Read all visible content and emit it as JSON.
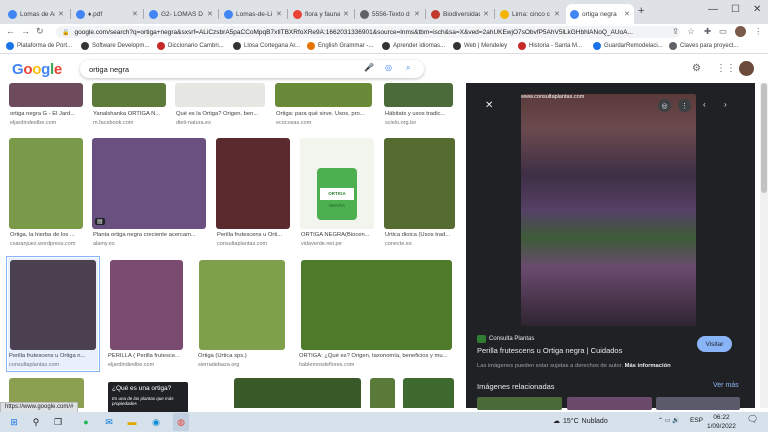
{
  "browser": {
    "tabs": [
      {
        "label": "Lomas de Ar",
        "color": "#4285f4"
      },
      {
        "label": "♦.pdf",
        "color": "#4285f4"
      },
      {
        "label": "G2- LOMAS D",
        "color": "#4285f4"
      },
      {
        "label": "Lomas-de-Li",
        "color": "#4285f4"
      },
      {
        "label": "flora y fauna",
        "color": "#e94235"
      },
      {
        "label": "5556-Texto d",
        "color": "#5f6368"
      },
      {
        "label": "Biodiversidad",
        "color": "#c0392b"
      },
      {
        "label": "Lima: cinco c",
        "color": "#f4b400"
      },
      {
        "label": "ortiga negra",
        "color": "#4285f4"
      }
    ],
    "new_tab_label": "+",
    "window_controls": {
      "minimize": "—",
      "maximize": "☐",
      "close": "✕"
    },
    "url": "google.com/search?q=ortiga+negra&sxsrf=ALiCzsbrA5paCCoMpqB7xIlTBXRfoXRe9A:1662031336901&source=lnms&tbm=isch&sa=X&ved=2ahUKEwjO7sObvfP5AhV5lLkGHbhlANoQ_AUoA..."
  },
  "bookmarks": [
    {
      "label": "Plataforma de Port...",
      "color": "#1a73e8"
    },
    {
      "label": "Software Developm...",
      "color": "#333333"
    },
    {
      "label": "Diccionario Cambri...",
      "color": "#c62828"
    },
    {
      "label": "Llosa Cortegana Ar...",
      "color": "#333333"
    },
    {
      "label": "English Grammar -...",
      "color": "#e37400"
    },
    {
      "label": "Aprender idiomas...",
      "color": "#333333"
    },
    {
      "label": "Web | Mendeley",
      "color": "#333333"
    },
    {
      "label": "Historia - Santa M...",
      "color": "#c62828"
    },
    {
      "label": "GuardarRemodelaci...",
      "color": "#1a73e8"
    },
    {
      "label": "Claves para proyect...",
      "color": "#5f6368"
    }
  ],
  "google": {
    "logo": "Google",
    "query": "ortiga negra"
  },
  "results": [
    {
      "caption": "ortiga negra G - El Jard...",
      "source": "eljardindeelbe.com",
      "color": "#6d4a5c"
    },
    {
      "caption": "Yanalshanka ORTIGA N...",
      "source": "m.facebook.com",
      "color": "#5e7a3a"
    },
    {
      "caption": "Qué es la Ortiga? Origen, ben...",
      "source": "dieti-natura.es",
      "color": "#e6e6e2"
    },
    {
      "caption": "Ortiga: para qué sirve. Usos, pro...",
      "source": "ecocosas.com",
      "color": "#6a8a3a"
    },
    {
      "caption": "Hábitats y usos tradic...",
      "source": "scielo.org.bo",
      "color": "#4b6b3a"
    },
    {
      "caption": "Ortiga, la hierba de los ...",
      "source": "csaranjuez.wordpress.com",
      "color": "#7a9a4a"
    },
    {
      "caption": "Planta ortiga negra creciente acercam...",
      "source": "alamy.es",
      "color": "#6a5080"
    },
    {
      "caption": "Perilla frutescens u Orti...",
      "source": "consultaplantas.com",
      "color": "#5b2a2e"
    },
    {
      "caption": "ORTIGA NEGRA(Biocen...",
      "source": "vidaverde.net.pe",
      "color": "#f1f5ee"
    },
    {
      "caption": "Urtica dioica (Usos trad...",
      "source": "conecte.es",
      "color": "#556b2f"
    },
    {
      "caption": "Perilla frutescens u Ortiga n...",
      "source": "consultaplantas.com",
      "color": "#4a4050"
    },
    {
      "caption": "PERILLA ( Perilla frutesce...",
      "source": "eljardindeelbe.com",
      "color": "#7a4a70"
    },
    {
      "caption": "Ortiga (Urtica sps.)",
      "source": "sierradebaza.org",
      "color": "#7fa04a"
    },
    {
      "caption": "ORTIGA: ¿Qué es? Origen, taxonomía, beneficios y mu...",
      "source": "hablemosdeflores.com",
      "color": "#4f7a2a"
    },
    {
      "caption": "",
      "source": "",
      "color": "#8aa050"
    },
    {
      "caption": "",
      "source": "",
      "color": "#3a5a2a"
    },
    {
      "caption": "",
      "source": "",
      "color": "#5a7a3a"
    },
    {
      "caption": "",
      "source": "",
      "color": "#3f6a2f"
    }
  ],
  "vidaverde_label": "ORTIGA NEGRA",
  "tooltip": {
    "title": "¿Qué es una ortiga?",
    "subtitle": "Es una de las plantas que más propiedades"
  },
  "panel": {
    "watermark": "www.consultaplantas.com",
    "source_name": "Consulta Plantas",
    "title": "Perilla frutescens u Ortiga negra | Cuidados",
    "visit_label": "Visitar",
    "note": "Las imágenes pueden estar sujetas a derechos de autor.",
    "note_link": "Más información",
    "related_label": "Imágenes relacionadas",
    "more_label": "Ver más"
  },
  "status_url": "https://www.google.com/#",
  "taskbar": {
    "temperature": "15°C",
    "weather": "Nublado",
    "language": "ESP",
    "time": "06:22",
    "date": "1/09/2022"
  }
}
